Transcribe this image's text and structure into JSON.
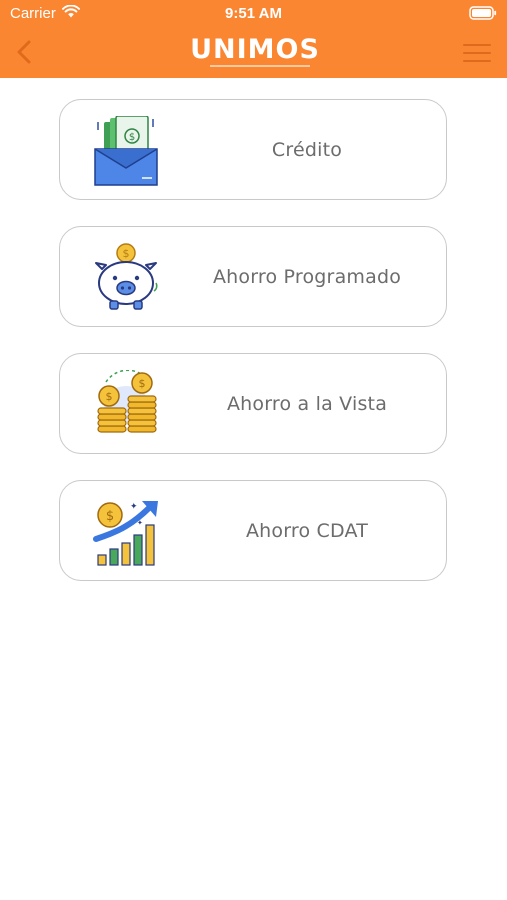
{
  "status_bar": {
    "carrier": "Carrier",
    "time": "9:51 AM"
  },
  "navbar": {
    "logo_text": "UNIMOS",
    "colors": {
      "bar": "#fb8632",
      "accent": "#e0691b"
    }
  },
  "menu": {
    "items": [
      {
        "label": "Crédito",
        "icon": "money-box-icon"
      },
      {
        "label": "Ahorro Programado",
        "icon": "piggy-bank-icon"
      },
      {
        "label": "Ahorro a la Vista",
        "icon": "coin-stacks-icon"
      },
      {
        "label": "Ahorro CDAT",
        "icon": "growth-chart-icon"
      }
    ]
  }
}
